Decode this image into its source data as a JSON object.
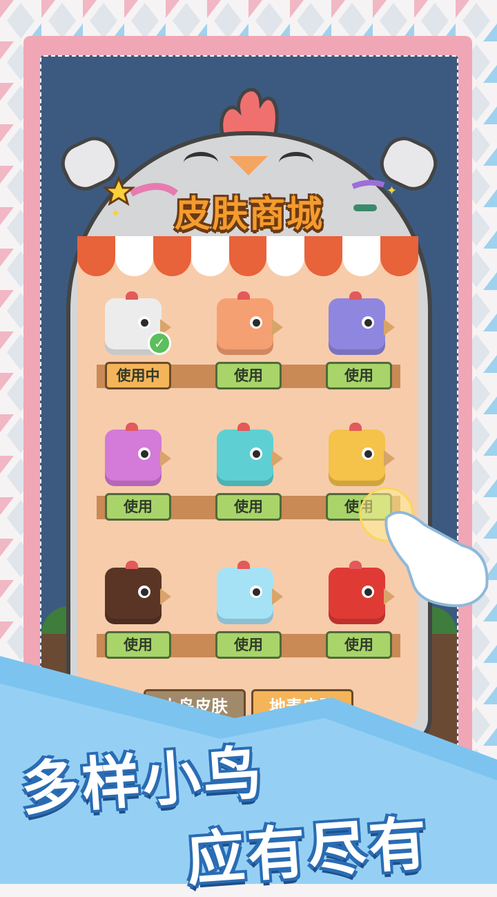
{
  "title": "皮肤商城",
  "slogan": {
    "line1": "多样小鸟",
    "line2": "应有尽有"
  },
  "tabs": [
    {
      "label": "小鸟皮肤",
      "active": true
    },
    {
      "label": "地表皮肤",
      "active": false
    }
  ],
  "skins": [
    {
      "color": "#ececec",
      "status": "使用中",
      "equipped": true
    },
    {
      "color": "#f5a072",
      "status": "使用",
      "equipped": false
    },
    {
      "color": "#8f86e0",
      "status": "使用",
      "equipped": false
    },
    {
      "color": "#d47ad8",
      "status": "使用",
      "equipped": false
    },
    {
      "color": "#5ed0d4",
      "status": "使用",
      "equipped": false
    },
    {
      "color": "#f5c24a",
      "status": "使用",
      "equipped": false
    },
    {
      "color": "#5a3526",
      "status": "使用",
      "equipped": false
    },
    {
      "color": "#a5e2f5",
      "status": "使用",
      "equipped": false
    },
    {
      "color": "#e03a35",
      "status": "使用",
      "equipped": false
    }
  ],
  "colors": {
    "frame": "#f1a6b6",
    "board_bg": "#3c5a7f",
    "panel": "#f7ccab",
    "accent": "#f59b2e",
    "banner": "#7cc4ef"
  }
}
